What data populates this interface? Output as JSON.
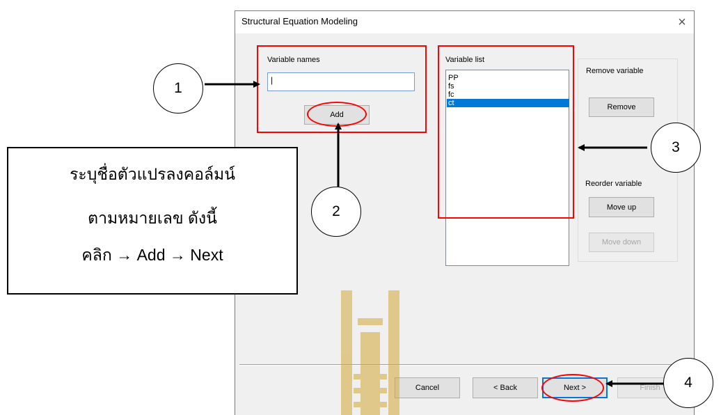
{
  "dialog": {
    "title": "Structural Equation Modeling",
    "close_glyph": "×"
  },
  "variable_names": {
    "group_label": "Variable names",
    "input_value": "|",
    "add_label": "Add"
  },
  "variable_list": {
    "group_label": "Variable list",
    "items": [
      "PP",
      "fs",
      "fc",
      "ct"
    ],
    "selected": "ct"
  },
  "remove_section": {
    "group_label": "Remove variable",
    "button_label": "Remove"
  },
  "reorder_section": {
    "group_label": "Reorder variable",
    "move_up_label": "Move up",
    "move_down_label": "Move down"
  },
  "footer": {
    "cancel_label": "Cancel",
    "back_label": "< Back",
    "next_label": "Next >",
    "finish_label": "Finish"
  },
  "callouts": [
    "1",
    "2",
    "3",
    "4"
  ],
  "instructions": {
    "line1": "ระบุชื่อตัวแปรลงคอล์มน์",
    "line2": "ตามหมายเลข ดังนี้",
    "line3": "คลิก → Add → Next"
  },
  "colors": {
    "highlight": "#ff0000",
    "selection": "#0078d7",
    "watermark": "#d4a93a"
  }
}
